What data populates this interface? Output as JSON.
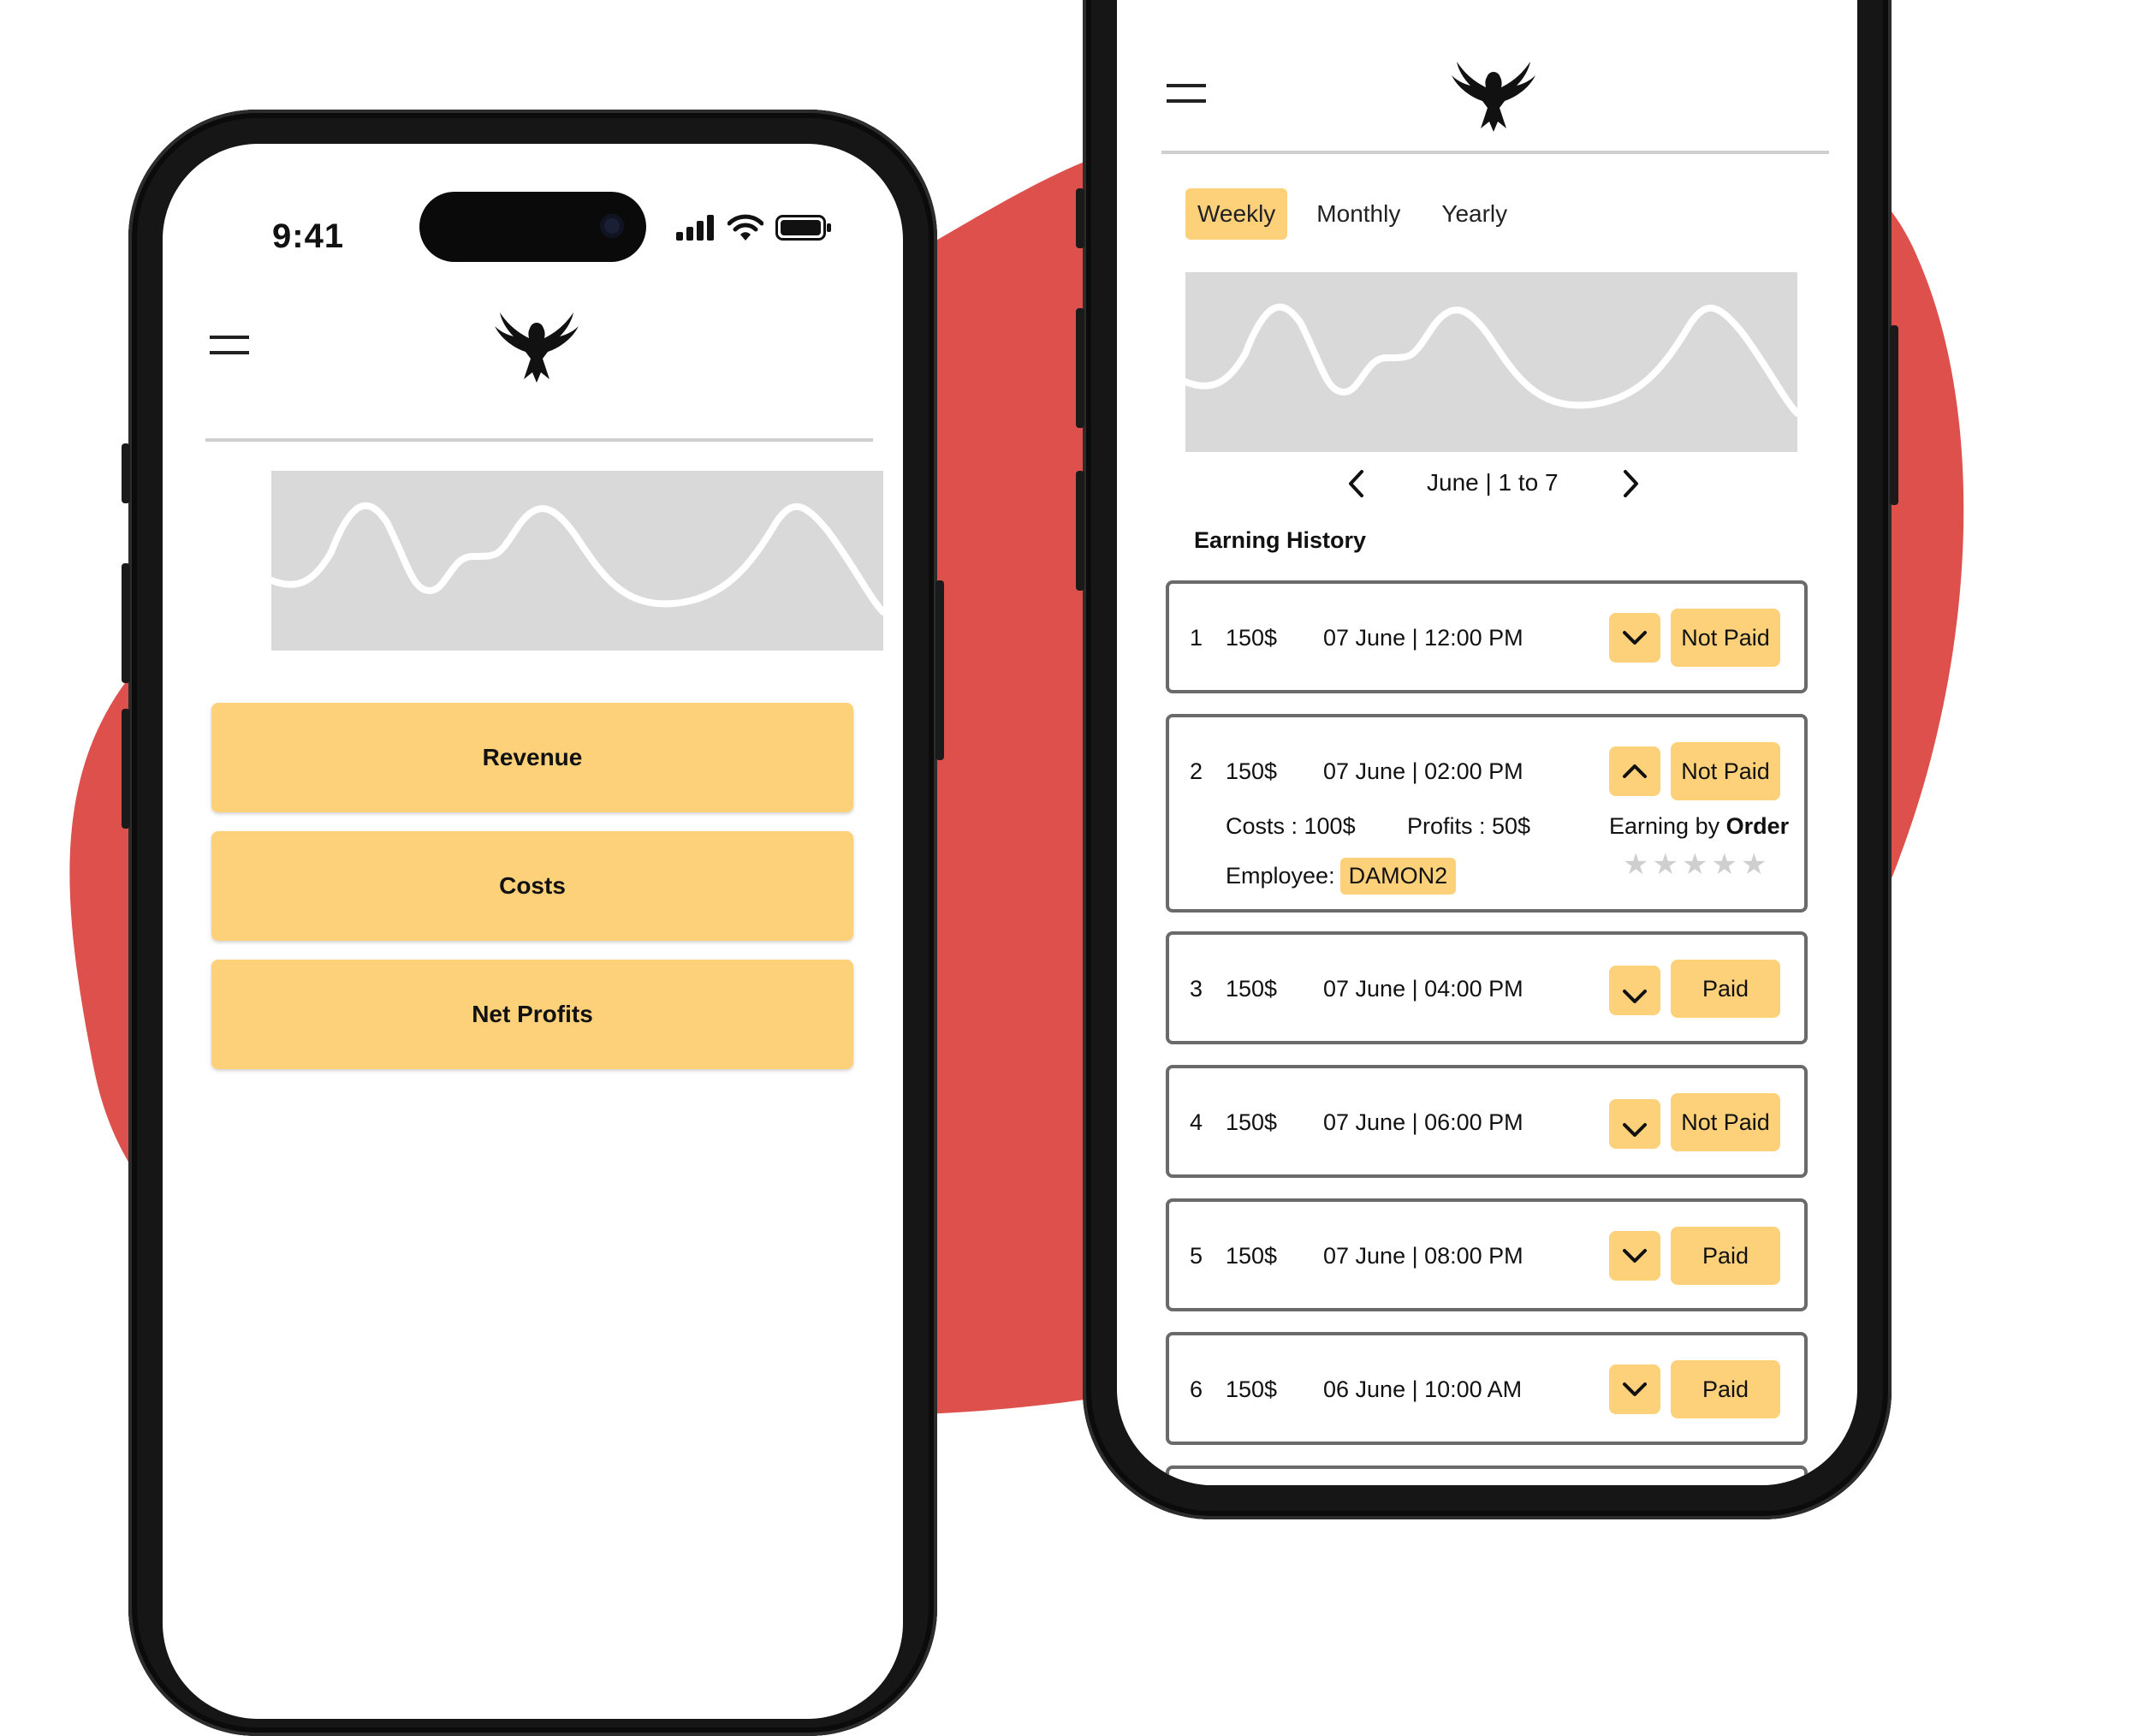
{
  "colors": {
    "accent": "#fdd17a",
    "blob": "#dd504b",
    "chart_bg": "#d9d9d9",
    "card_border": "#6a6a6a"
  },
  "left_phone": {
    "status_bar": {
      "time": "9:41",
      "icons": [
        "cellular-signal-icon",
        "wifi-icon",
        "battery-icon"
      ]
    },
    "header": {
      "menu_icon": "hamburger-menu-icon",
      "logo": "eagle-logo"
    },
    "buttons": [
      {
        "label": "Revenue"
      },
      {
        "label": "Costs"
      },
      {
        "label": "Net Profits"
      }
    ]
  },
  "right_phone": {
    "header": {
      "menu_icon": "hamburger-menu-icon",
      "logo": "eagle-logo"
    },
    "tabs": [
      {
        "label": "Weekly",
        "active": true
      },
      {
        "label": "Monthly",
        "active": false
      },
      {
        "label": "Yearly",
        "active": false
      }
    ],
    "period": "June | 1 to 7",
    "section_title": "Earning History",
    "entries": [
      {
        "index": "1",
        "amount": "150$",
        "datetime": "07 June | 12:00 PM",
        "status": "Not Paid",
        "expanded": false
      },
      {
        "index": "2",
        "amount": "150$",
        "datetime": "07 June | 02:00 PM",
        "status": "Not Paid",
        "expanded": true,
        "costs": "Costs : 100$",
        "profits": "Profits : 50$",
        "employee_label": "Employee:",
        "employee": "DAMON2",
        "earning_by": "Earning by",
        "earning_by_bold": "Order",
        "rating": 0,
        "rating_max": 5
      },
      {
        "index": "3",
        "amount": "150$",
        "datetime": "07 June | 04:00 PM",
        "status": "Paid",
        "expanded": false
      },
      {
        "index": "4",
        "amount": "150$",
        "datetime": "07 June | 06:00 PM",
        "status": "Not Paid",
        "expanded": false
      },
      {
        "index": "5",
        "amount": "150$",
        "datetime": "07 June | 08:00 PM",
        "status": "Paid",
        "expanded": false
      },
      {
        "index": "6",
        "amount": "150$",
        "datetime": "06 June | 10:00 AM",
        "status": "Paid",
        "expanded": false
      }
    ]
  }
}
